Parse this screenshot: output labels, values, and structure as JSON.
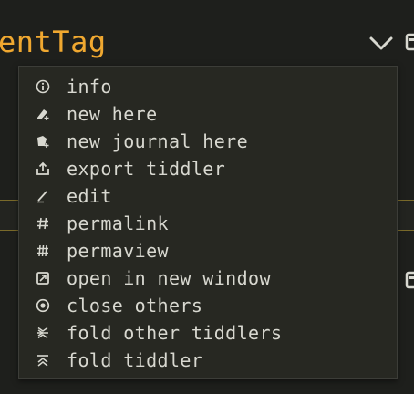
{
  "tiddler": {
    "title_fragment": "entTag"
  },
  "menu": {
    "items": [
      {
        "label": "info",
        "icon": "info-icon"
      },
      {
        "label": "new here",
        "icon": "new-here-icon"
      },
      {
        "label": "new journal here",
        "icon": "new-journal-icon"
      },
      {
        "label": "export tiddler",
        "icon": "export-icon"
      },
      {
        "label": "edit",
        "icon": "edit-icon"
      },
      {
        "label": "permalink",
        "icon": "permalink-icon"
      },
      {
        "label": "permaview",
        "icon": "permaview-icon"
      },
      {
        "label": "open in new window",
        "icon": "open-window-icon"
      },
      {
        "label": "close others",
        "icon": "close-others-icon"
      },
      {
        "label": "fold other tiddlers",
        "icon": "fold-others-icon"
      },
      {
        "label": "fold tiddler",
        "icon": "fold-icon"
      }
    ]
  },
  "colors": {
    "background": "#1e1f1c",
    "menu_background": "#272822",
    "title_accent": "#f0a830",
    "text": "#d8d8d0",
    "rule": "#7a6a2a"
  }
}
